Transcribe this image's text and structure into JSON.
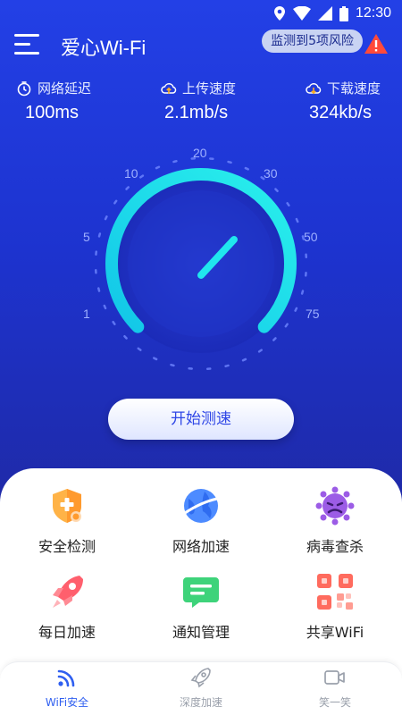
{
  "status_bar": {
    "time": "12:30"
  },
  "header": {
    "title": "爱心Wi-Fi",
    "risk_text": "监测到5项风险"
  },
  "stats": [
    {
      "label": "网络延迟",
      "value": "100ms",
      "icon": "clock-icon"
    },
    {
      "label": "上传速度",
      "value": "2.1mb/s",
      "icon": "cloud-upload-icon"
    },
    {
      "label": "下载速度",
      "value": "324kb/s",
      "icon": "cloud-download-icon"
    }
  ],
  "gauge": {
    "scale_labels": [
      "1",
      "5",
      "10",
      "20",
      "30",
      "50",
      "75"
    ]
  },
  "start_button": "开始测速",
  "features": [
    {
      "label": "安全检测",
      "icon": "shield-plus-icon"
    },
    {
      "label": "网络加速",
      "icon": "globe-icon"
    },
    {
      "label": "病毒查杀",
      "icon": "virus-icon"
    },
    {
      "label": "每日加速",
      "icon": "rocket-icon"
    },
    {
      "label": "通知管理",
      "icon": "message-icon"
    },
    {
      "label": "共享WiFi",
      "icon": "qr-share-icon"
    }
  ],
  "nav": [
    {
      "label": "WiFi安全",
      "icon": "wifi-signal-icon",
      "active": true
    },
    {
      "label": "深度加速",
      "icon": "rocket-outline-icon",
      "active": false
    },
    {
      "label": "笑一笑",
      "icon": "video-icon",
      "active": false
    }
  ],
  "colors": {
    "accent": "#2f5ff0",
    "gauge_cyan": "#1fe3ea",
    "bg_blue": "#1d2fd0"
  }
}
